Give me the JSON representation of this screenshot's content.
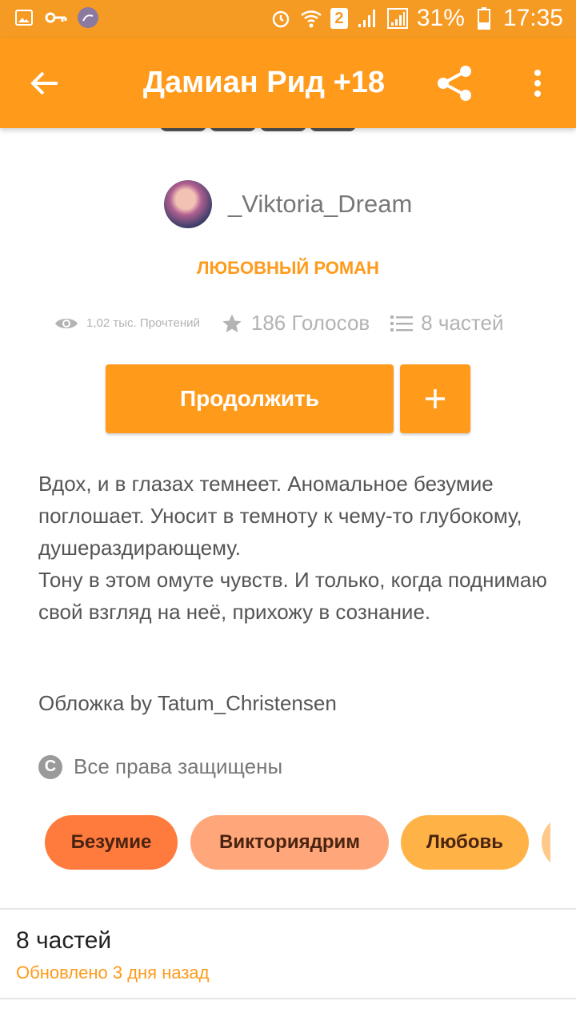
{
  "status_bar": {
    "battery": "31%",
    "time": "17:35",
    "sim_slot": "2"
  },
  "app_bar": {
    "title": "Дамиан Рид +18"
  },
  "story": {
    "author": "_Viktoria_Dream",
    "genre": "ЛЮБОВНЫЙ РОМАН",
    "reads": "1,02 тыс. Прочтений",
    "votes": "186 Голосов",
    "parts": "8 частей",
    "continue_label": "Продолжить",
    "add_label": "+",
    "description": [
      "Вдох, и в глазах темнеет. Аномальное безумие поглошает. Уносит в темноту к чему-то глубокому, душераздирающему.",
      "Тону в этом омуте чувств. И только, когда поднимаю свой взгляд на неё, прихожу в сознание."
    ],
    "cover_credit": "Обложка by Tatum_Christensen",
    "rights": "Все права защищены",
    "copyright_symbol": "C",
    "tags": [
      {
        "label": "Безумие",
        "color": "#ff7a3d"
      },
      {
        "label": "Викториядрим",
        "color": "#ffa77a"
      },
      {
        "label": "Любовь",
        "color": "#ffb347"
      }
    ]
  },
  "parts_section": {
    "title": "8 частей",
    "updated": "Обновлено 3 дня назад"
  },
  "colors": {
    "accent": "#ff9a1a",
    "status_bar": "#f59a23"
  }
}
